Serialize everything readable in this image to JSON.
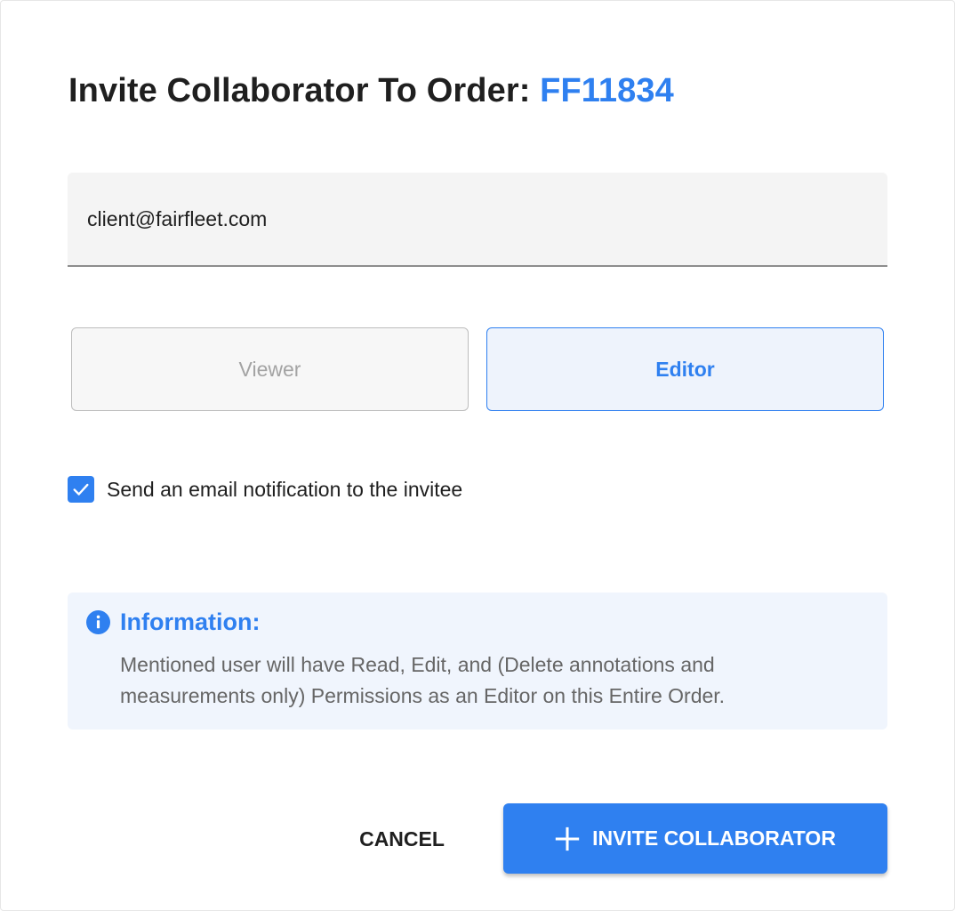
{
  "dialog": {
    "title_prefix": "Invite Collaborator To Order:",
    "order_id": "FF11834"
  },
  "email_field": {
    "value": "client@fairfleet.com"
  },
  "roles": {
    "viewer_label": "Viewer",
    "editor_label": "Editor",
    "selected": "Editor"
  },
  "notification": {
    "checked": true,
    "label": "Send an email notification to the invitee"
  },
  "info": {
    "icon": "info-icon",
    "title": "Information:",
    "text": "Mentioned user will have Read, Edit, and (Delete annotations and measurements only) Permissions as an Editor on this Entire Order."
  },
  "actions": {
    "cancel_label": "CANCEL",
    "invite_label": "INVITE COLLABORATOR",
    "invite_icon": "plus-icon"
  },
  "colors": {
    "accent": "#2f80f0",
    "info_bg": "#f0f5fd",
    "field_bg": "#f4f4f4"
  }
}
